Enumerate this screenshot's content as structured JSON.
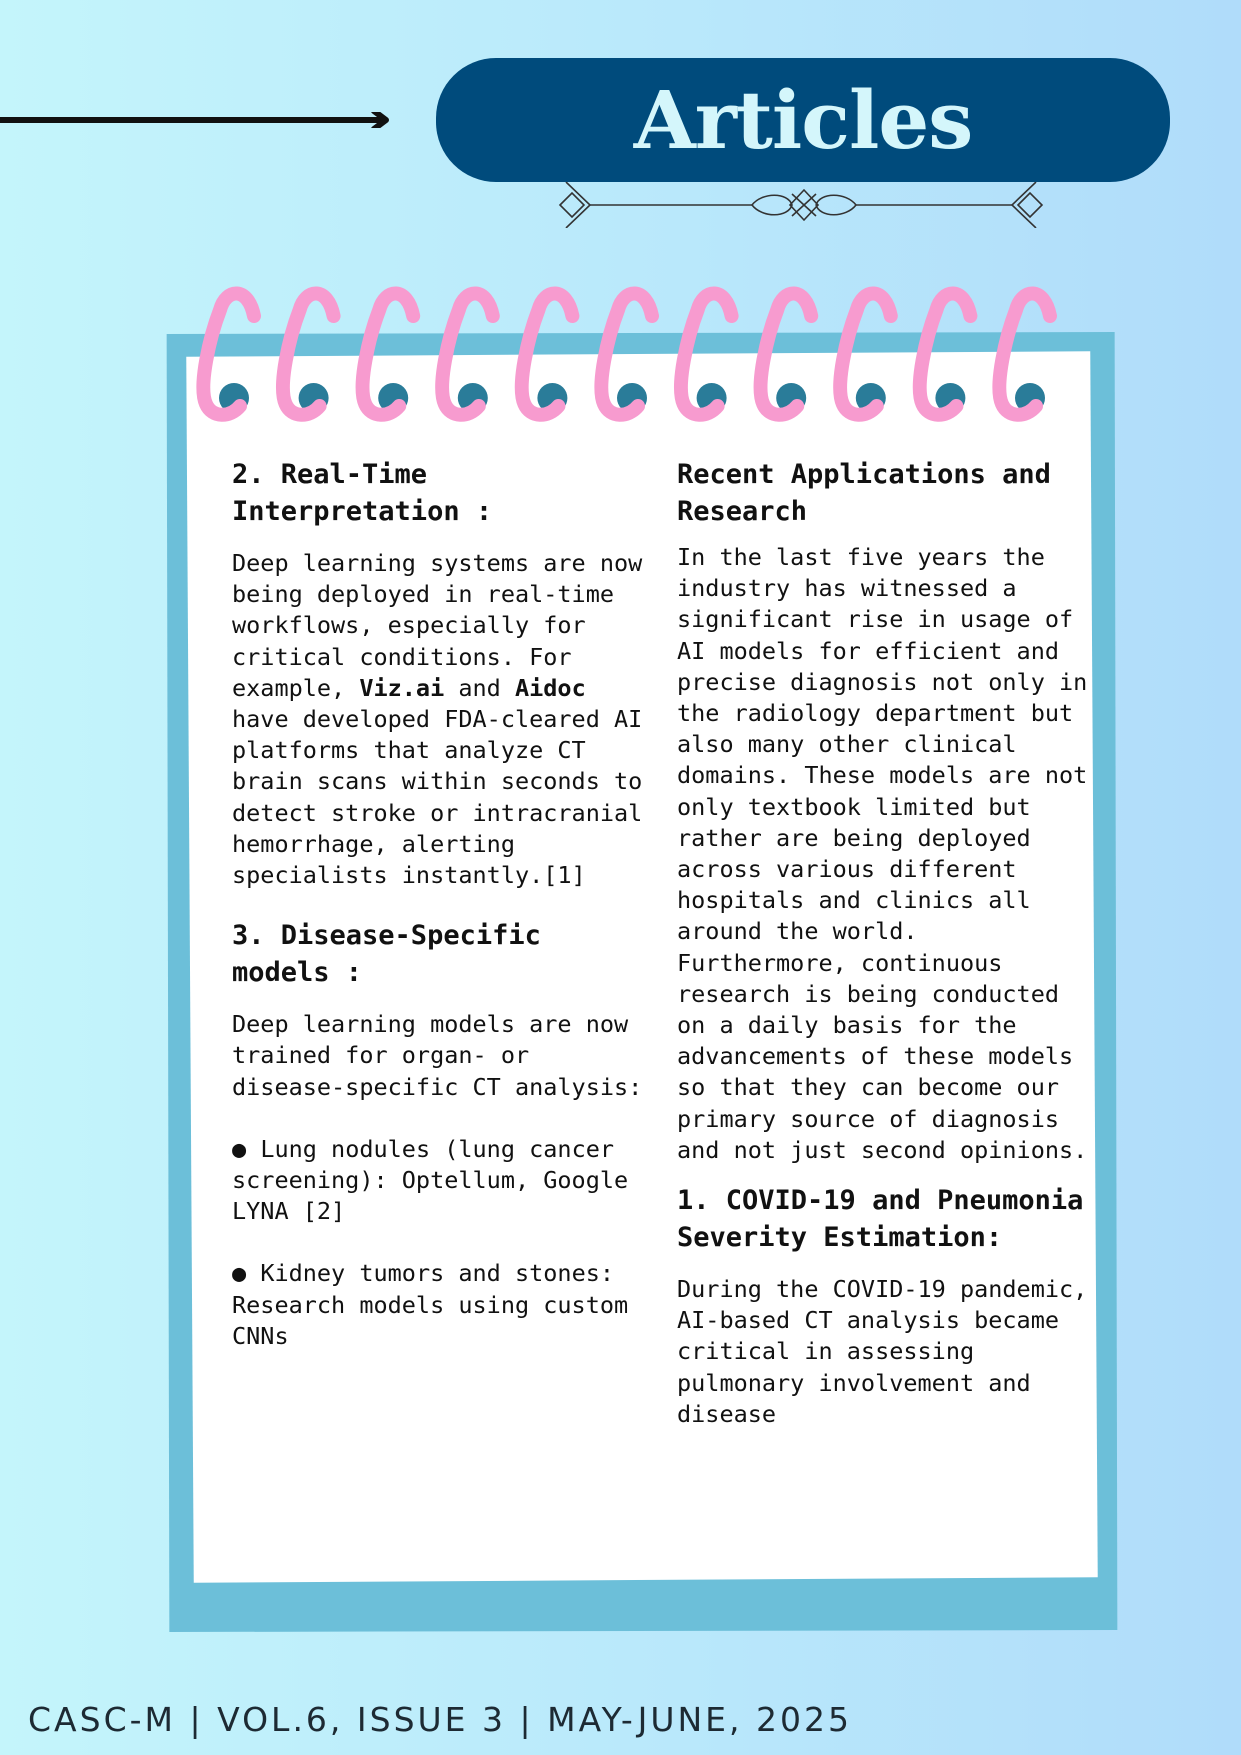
{
  "header": {
    "title": "Articles"
  },
  "left_column": {
    "s2_heading": "2. Real-Time Interpretation :",
    "s2_p_a": "Deep learning systems are now being deployed in real-time workflows, especially for critical conditions. For example, ",
    "s2_b1": "Viz.ai",
    "s2_and": " and ",
    "s2_b2": "Aidoc",
    "s2_p_b": " have developed FDA-cleared AI platforms that analyze CT brain scans within seconds to detect stroke or intracranial hemorrhage, alerting specialists instantly.[1]",
    "s3_heading": "3. Disease-Specific models :",
    "s3_intro": "Deep learning models are now trained for organ- or disease-specific CT analysis:",
    "bullet_mark": "●",
    "bullets": [
      "Lung nodules (lung cancer screening): Optellum, Google LYNA [2]",
      "Kidney tumors and stones: Research models using custom CNNs"
    ]
  },
  "right_column": {
    "r_heading": "Recent Applications and Research",
    "r_para": "In the last five years the industry has witnessed a significant rise in usage of AI models for efficient and precise diagnosis not only in the radiology department but also many other clinical domains. These models are not only textbook limited but rather are being deployed across various different hospitals and clinics all around the world. Furthermore, continuous research is being conducted on a daily basis for the advancements of these models so that they can become our primary source of diagnosis and not just second opinions.",
    "s1_heading": "1. COVID-19 and Pneumonia Severity Estimation:",
    "s1_para": "During the COVID-19 pandemic, AI-based CT analysis became critical in assessing pulmonary involvement and disease"
  },
  "footer": {
    "text": "CASC-M | VOL.6, ISSUE 3 | MAY-JUNE, 2025"
  },
  "icons": [
    "arrow-right-icon",
    "ornament-divider-icon",
    "spiral-ring-icon"
  ],
  "colors": {
    "title_bg": "#004b7c",
    "title_text": "#d4f6fb",
    "notebook_border": "#6cbfd9",
    "ring": "#f79bcf",
    "ring_hole": "#2a7c99"
  }
}
